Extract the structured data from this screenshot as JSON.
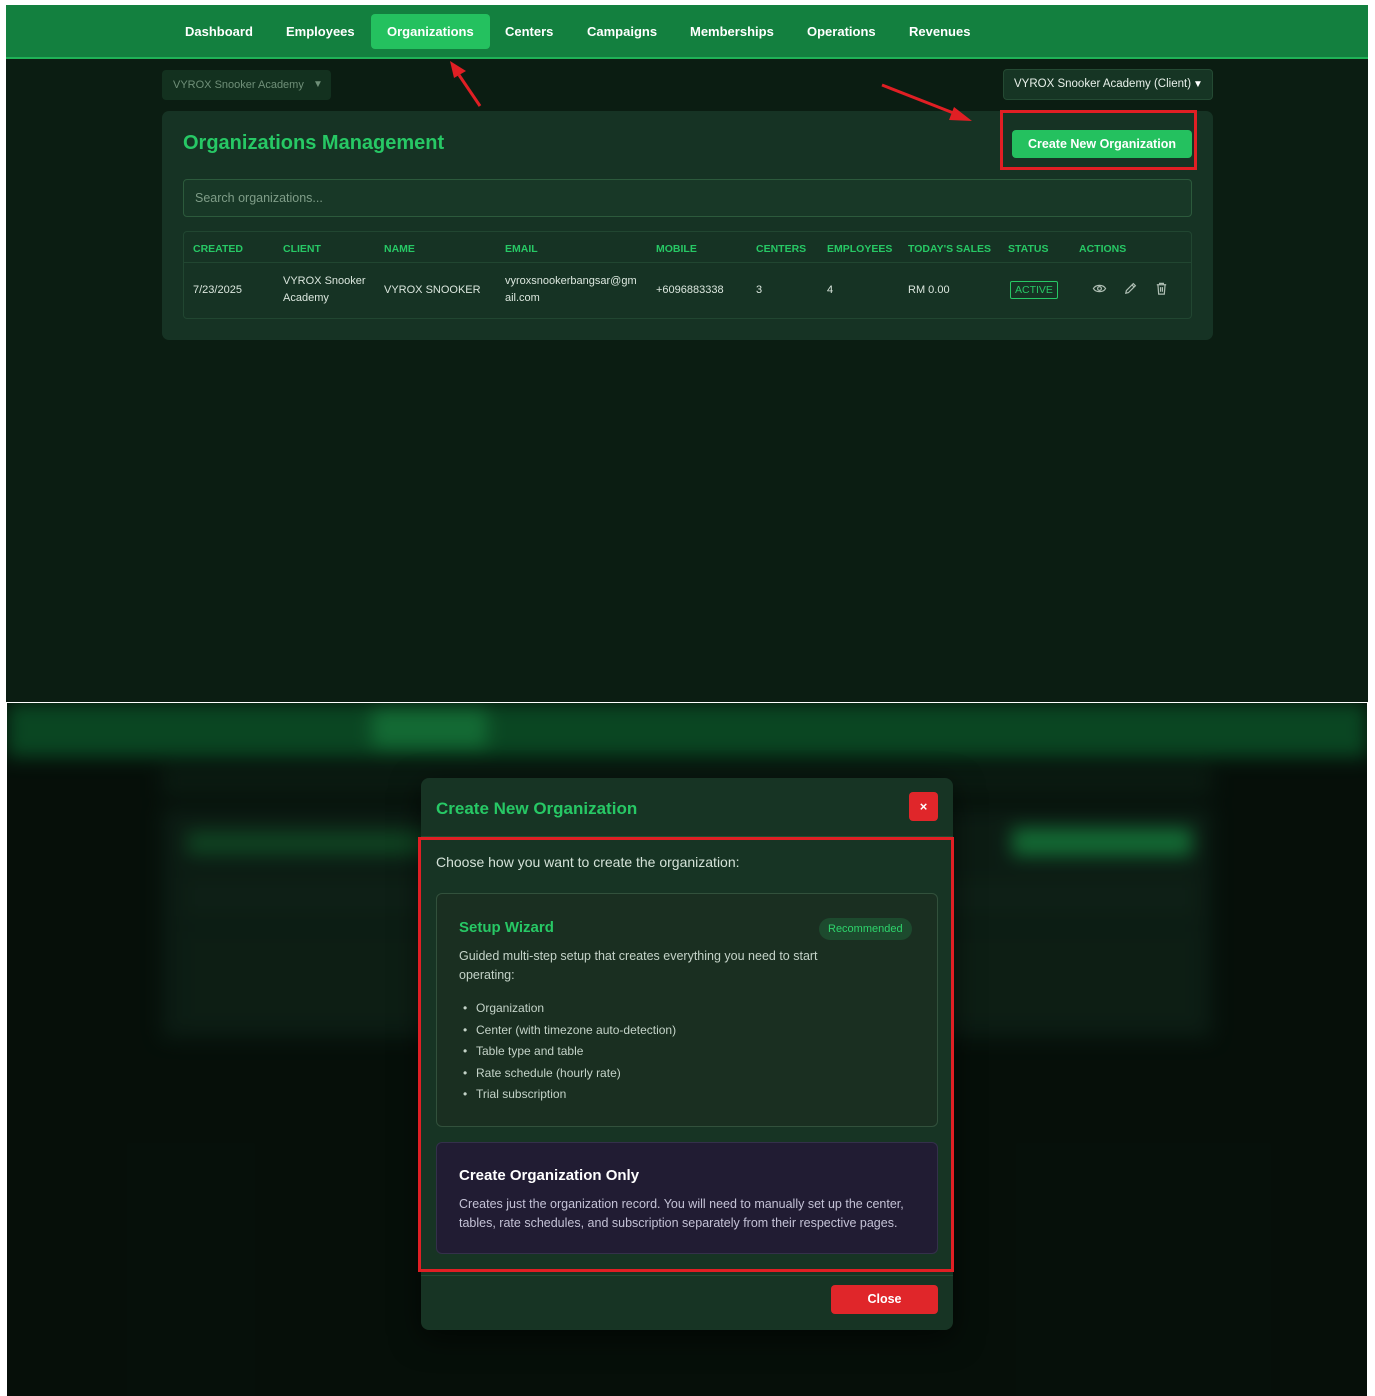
{
  "nav": {
    "items": [
      {
        "label": "Dashboard"
      },
      {
        "label": "Employees"
      },
      {
        "label": "Organizations",
        "active": true
      },
      {
        "label": "Centers"
      },
      {
        "label": "Campaigns"
      },
      {
        "label": "Memberships"
      },
      {
        "label": "Operations"
      },
      {
        "label": "Revenues"
      }
    ]
  },
  "org_selector": {
    "value": "VYROX Snooker Academy"
  },
  "client_selector": {
    "value": "VYROX Snooker Academy (Client)"
  },
  "management": {
    "title": "Organizations Management",
    "create_button": "Create New Organization",
    "search_placeholder": "Search organizations..."
  },
  "table": {
    "headers": [
      "CREATED",
      "CLIENT",
      "NAME",
      "EMAIL",
      "MOBILE",
      "CENTERS",
      "EMPLOYEES",
      "TODAY'S SALES",
      "STATUS",
      "ACTIONS"
    ],
    "rows": [
      {
        "created": "7/23/2025",
        "client": "VYROX Snooker Academy",
        "name": "VYROX SNOOKER",
        "email": "vyroxsnookerbangsar@gmail.com",
        "mobile": "+6096883338",
        "centers": "3",
        "employees": "4",
        "sales": "RM 0.00",
        "status": "ACTIVE"
      }
    ]
  },
  "modal": {
    "title": "Create New Organization",
    "close_x": "×",
    "intro": "Choose how you want to create the organization:",
    "wizard": {
      "title": "Setup Wizard",
      "badge": "Recommended",
      "description": "Guided multi-step setup that creates everything you need to start operating:",
      "items": [
        "Organization",
        "Center (with timezone auto-detection)",
        "Table type and table",
        "Rate schedule (hourly rate)",
        "Trial subscription"
      ]
    },
    "only": {
      "title": "Create Organization Only",
      "description": "Creates just the organization record. You will need to manually set up the center, tables, rate schedules, and subscription separately from their respective pages."
    },
    "close_button": "Close"
  },
  "colors": {
    "nav_bg": "#13803f",
    "accent": "#27c865",
    "active_tab": "#24c15f",
    "page_bg": "#0b1d12",
    "card_bg": "#163324",
    "annotation_red": "#e01f24",
    "danger": "#e0262a"
  },
  "icons": [
    "eye-icon",
    "pencil-icon",
    "trash-icon",
    "chevron-down-icon",
    "close-icon"
  ]
}
